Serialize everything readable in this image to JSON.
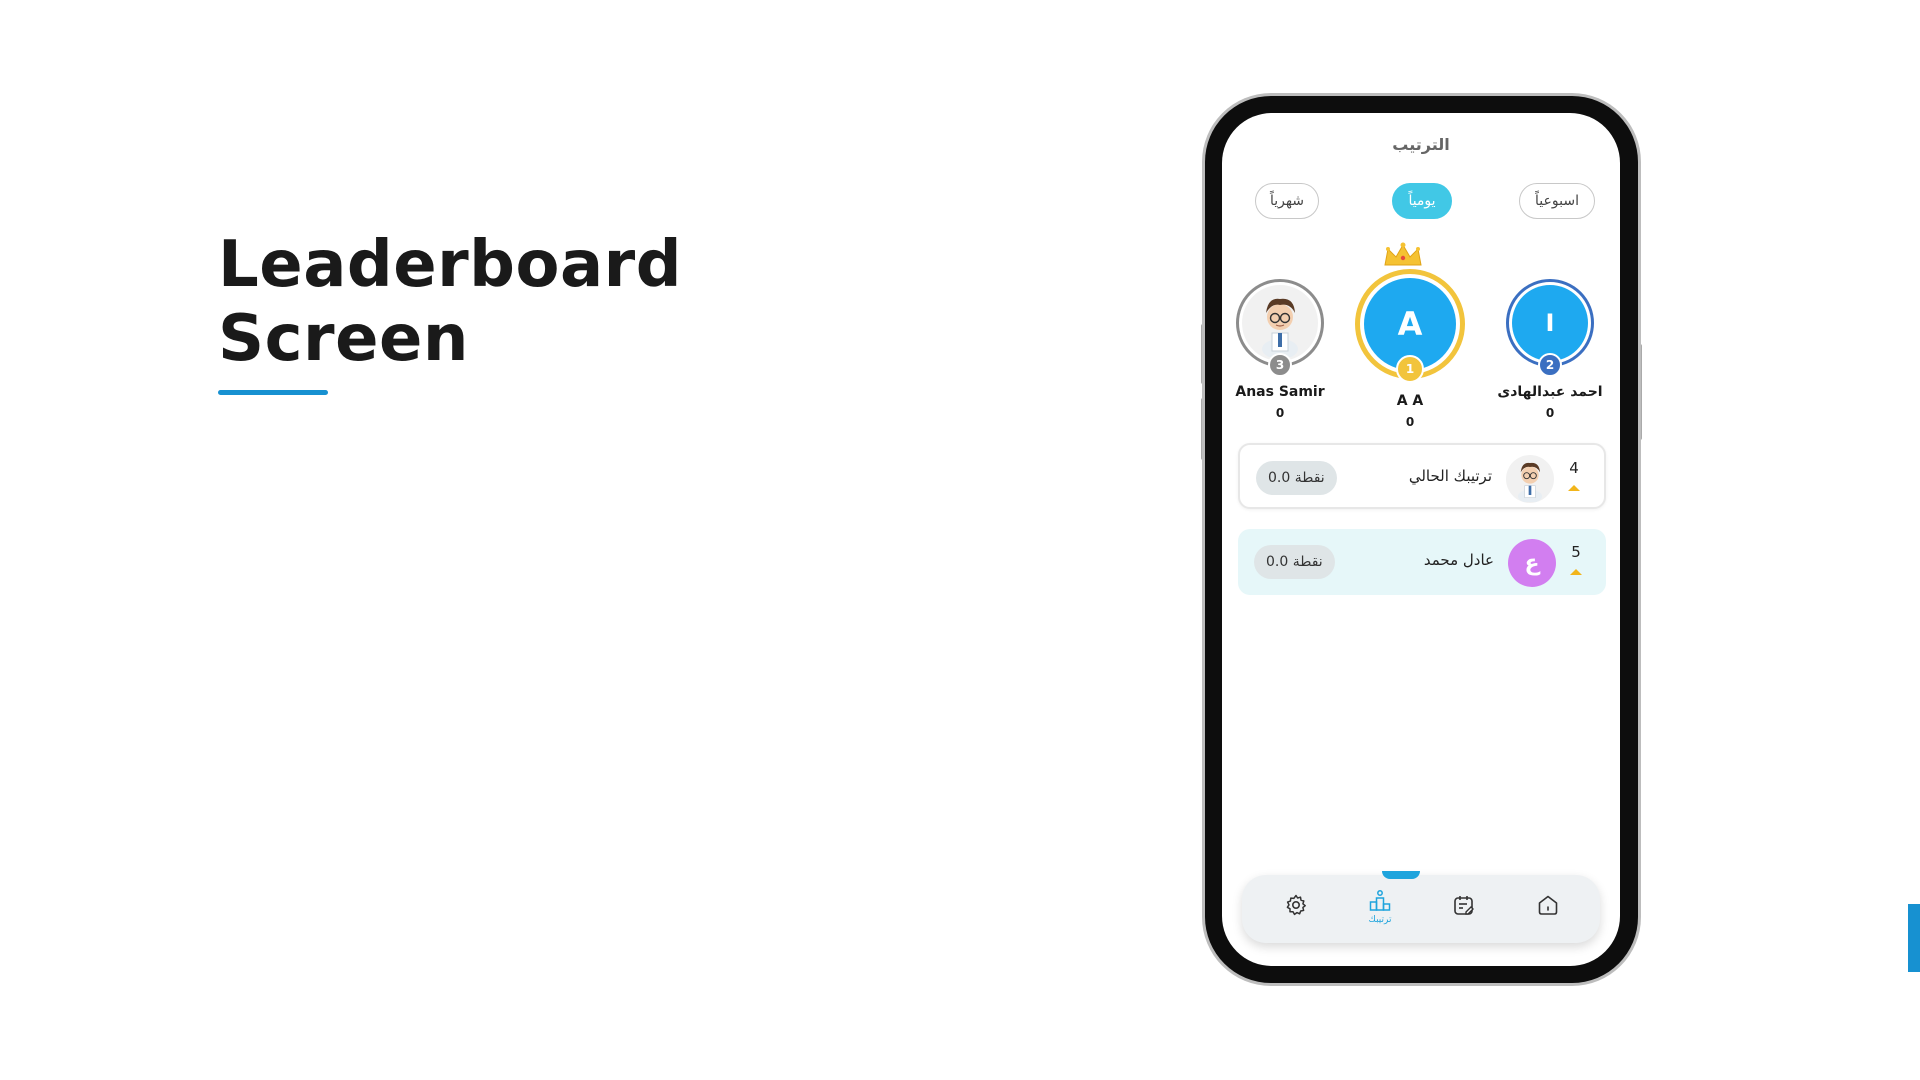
{
  "slide": {
    "title_line1": "Leaderboard",
    "title_line2": "Screen",
    "accent_color": "#1791d1"
  },
  "app": {
    "screen_title": "الترتيب",
    "tabs": [
      {
        "label": "اسبوعياً",
        "active": false
      },
      {
        "label": "يومياً",
        "active": true
      },
      {
        "label": "شهرياً",
        "active": false
      }
    ],
    "podium": {
      "first": {
        "initial": "A",
        "name": "A A",
        "score": "0",
        "rank": "1",
        "crown": "crown-icon",
        "color": "#1ea9f0",
        "ring_color": "#f2c43c"
      },
      "second": {
        "initial": "I",
        "name": "احمد عبدالهادى",
        "score": "0",
        "rank": "2",
        "color": "#1ea9f0",
        "ring_color": "#3b6fc1"
      },
      "third": {
        "avatar": "cartoon-doctor-avatar",
        "name": "Anas Samir",
        "score": "0",
        "rank": "3",
        "ring_color": "#8c8c8c"
      }
    },
    "rows": [
      {
        "rank": "4",
        "name": "ترتيبك الحالي",
        "points": "نقطة 0.0",
        "avatar": "cartoon-doctor-avatar",
        "current_user": true
      },
      {
        "rank": "5",
        "name": "عادل محمد",
        "points": "نقطة 0.0",
        "initial": "ع",
        "avatar_color": "#d27ef0",
        "current_user": false
      }
    ],
    "nav": {
      "items": [
        {
          "icon": "gear-icon"
        },
        {
          "icon": "leaderboard-icon",
          "label": "ترتيبك",
          "active": true
        },
        {
          "icon": "calendar-edit-icon"
        },
        {
          "icon": "home-icon"
        }
      ],
      "active_color": "#1ea4dd"
    }
  }
}
